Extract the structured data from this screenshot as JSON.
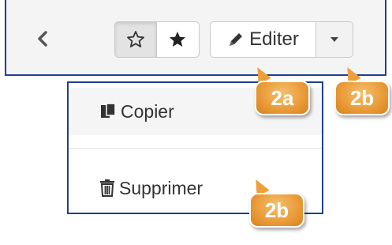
{
  "toolbar": {
    "back_icon": "chevron-left-icon",
    "star_outline_icon": "star-outline-icon",
    "star_filled_icon": "star-filled-icon",
    "edit_icon": "pencil-icon",
    "edit_label": "Editer",
    "caret_icon": "caret-down-icon"
  },
  "menu": {
    "items": [
      {
        "label": "Copier",
        "icon": "copy-icon"
      },
      {
        "label": "Supprimer",
        "icon": "trash-icon"
      }
    ]
  },
  "callouts": {
    "edit": "2a",
    "caret": "2b",
    "delete": "2b"
  },
  "colors": {
    "frame": "#1f3f8f",
    "callout": "#e99a37",
    "toolbar_bg": "#f4f4f4"
  }
}
